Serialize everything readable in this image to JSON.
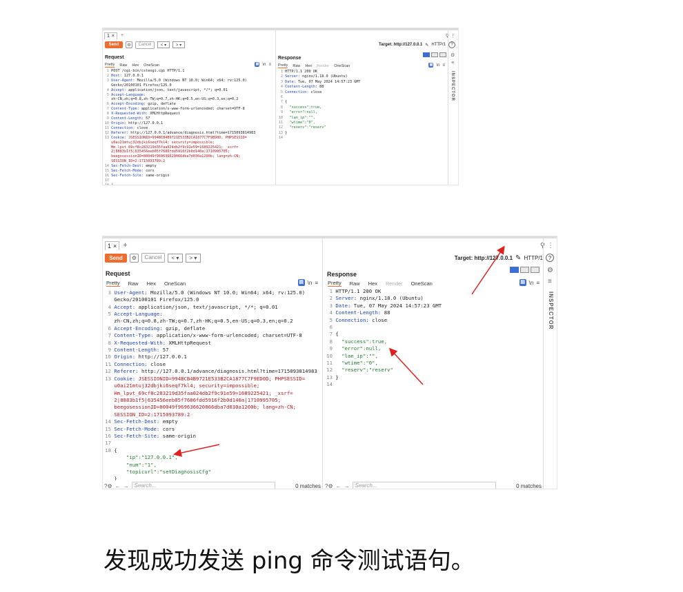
{
  "burp": {
    "tab_label": "1",
    "tab_close": "×",
    "new_tab": "+",
    "send_label": "Send",
    "cancel_label": "Cancel",
    "target_label": "Target: http://127.0.0.1",
    "protocol": "HTTP/1",
    "help": "?",
    "request_title": "Request",
    "response_title": "Response",
    "request_tabs": [
      "Pretty",
      "Raw",
      "Hex",
      "OneScan"
    ],
    "response_tabs": [
      "Pretty",
      "Raw",
      "Hex",
      "Render",
      "OneScan"
    ],
    "inspector_label": "INSPECTOR",
    "search_placeholder": "Search...",
    "matches": "0 matches",
    "newline_toggle": "\\n",
    "menu_icon": "≡",
    "request_lines": [
      {
        "n": "1",
        "k": "",
        "v": "POST /cgi-bin/csteogi.cgi HTTP/1.1"
      },
      {
        "n": "2",
        "k": "Host:",
        "v": " 127.0.0.1"
      },
      {
        "n": "3",
        "k": "User-Agent:",
        "v": " Mozilla/5.0 (Windows NT 10.0; Win64; x64; rv:125.0)"
      },
      {
        "n": "",
        "k": "",
        "v": "Gecko/20100101 Firefox/125.0"
      },
      {
        "n": "4",
        "k": "Accept:",
        "v": " application/json, text/javascript, */*; q=0.01"
      },
      {
        "n": "5",
        "k": "Accept-Language:",
        "v": ""
      },
      {
        "n": "",
        "k": "",
        "v": "zh-CN,zh;q=0.8,zh-TW;q=0.7,zh-HK;q=0.5,en-US;q=0.3,en;q=0.2"
      },
      {
        "n": "6",
        "k": "Accept-Encoding:",
        "v": " gzip, deflate"
      },
      {
        "n": "7",
        "k": "Content-Type:",
        "v": " application/x-www-form-urlencoded; charset=UTF-8"
      },
      {
        "n": "8",
        "k": "X-Requested-With:",
        "v": " XMLHttpRequest"
      },
      {
        "n": "9",
        "k": "Content-Length:",
        "v": " 57"
      },
      {
        "n": "10",
        "k": "Origin:",
        "v": " http://127.0.0.1"
      },
      {
        "n": "11",
        "k": "Connection:",
        "v": " close"
      },
      {
        "n": "12",
        "k": "Referer:",
        "v": " http://127.0.0.1/advance/diagnosis.html?time=1715093814983"
      },
      {
        "n": "13",
        "k": "Cookie:",
        "v": " ",
        "r": "JSESSIONID=994BCB4B9721E533B2CA1877C7F9ED0D; PHPSESSID="
      },
      {
        "n": "",
        "k": "",
        "v": "",
        "r": "u0ai21mtuj32dbjki6seqf7kl4; security=impossible;"
      },
      {
        "n": "",
        "k": "",
        "v": "",
        "r": "Hm_lpvt_69cf8c283219d35faa024db2f9c91e59=1689225421; _xsrf="
      },
      {
        "n": "",
        "k": "",
        "v": "",
        "r": "2|8883b1f5|635456eeb05f7686fdd5916f2b0d140a|1710995705;"
      },
      {
        "n": "",
        "k": "",
        "v": "",
        "r": "beegosessionID=80049f969636620066dba7d030a1200b; lang=zh-CN;"
      },
      {
        "n": "",
        "k": "",
        "v": "",
        "r": "SESSION_ID=2:1715093789:2"
      },
      {
        "n": "14",
        "k": "Sec-Fetch-Dest:",
        "v": " empty"
      },
      {
        "n": "15",
        "k": "Sec-Fetch-Mode:",
        "v": " cors"
      },
      {
        "n": "16",
        "k": "Sec-Fetch-Site:",
        "v": " same-origin"
      },
      {
        "n": "17",
        "k": "",
        "v": ""
      },
      {
        "n": "18",
        "k": "",
        "v": "{"
      },
      {
        "n": "",
        "k": "",
        "v": "    ",
        "g": "\"ip\":\"127.0.0.1\","
      },
      {
        "n": "",
        "k": "",
        "v": "    ",
        "g": "\"num\":\"1\","
      },
      {
        "n": "",
        "k": "",
        "v": "    ",
        "g": "\"topicurl\":\"setDiagnosisCfg\""
      },
      {
        "n": "",
        "k": "",
        "v": "}"
      }
    ],
    "response_lines": [
      {
        "n": "1",
        "k": "",
        "v": "HTTP/1.1 200 OK"
      },
      {
        "n": "2",
        "k": "Server:",
        "v": " nginx/1.18.0 (Ubuntu)"
      },
      {
        "n": "3",
        "k": "Date:",
        "v": " Tue, 07 May 2024 14:57:23 GMT"
      },
      {
        "n": "4",
        "k": "Content-Length:",
        "v": " 88"
      },
      {
        "n": "5",
        "k": "Connection:",
        "v": " close"
      },
      {
        "n": "6",
        "k": "",
        "v": ""
      },
      {
        "n": "7",
        "k": "",
        "v": "{"
      },
      {
        "n": "8",
        "k": "",
        "v": "  ",
        "g": "\"success\":true,"
      },
      {
        "n": "9",
        "k": "",
        "v": "  ",
        "g": "\"error\":null,"
      },
      {
        "n": "10",
        "k": "",
        "v": "  ",
        "g": "\"lan_ip\":\"\","
      },
      {
        "n": "11",
        "k": "",
        "v": "  ",
        "g": "\"wtime\":\"0\","
      },
      {
        "n": "12",
        "k": "",
        "v": "  ",
        "g": "\"reserv\":\"reserv\""
      },
      {
        "n": "13",
        "k": "",
        "v": "}"
      },
      {
        "n": "14",
        "k": "",
        "v": ""
      }
    ]
  },
  "caption": "发现成功发送 ping 命令测试语句。"
}
